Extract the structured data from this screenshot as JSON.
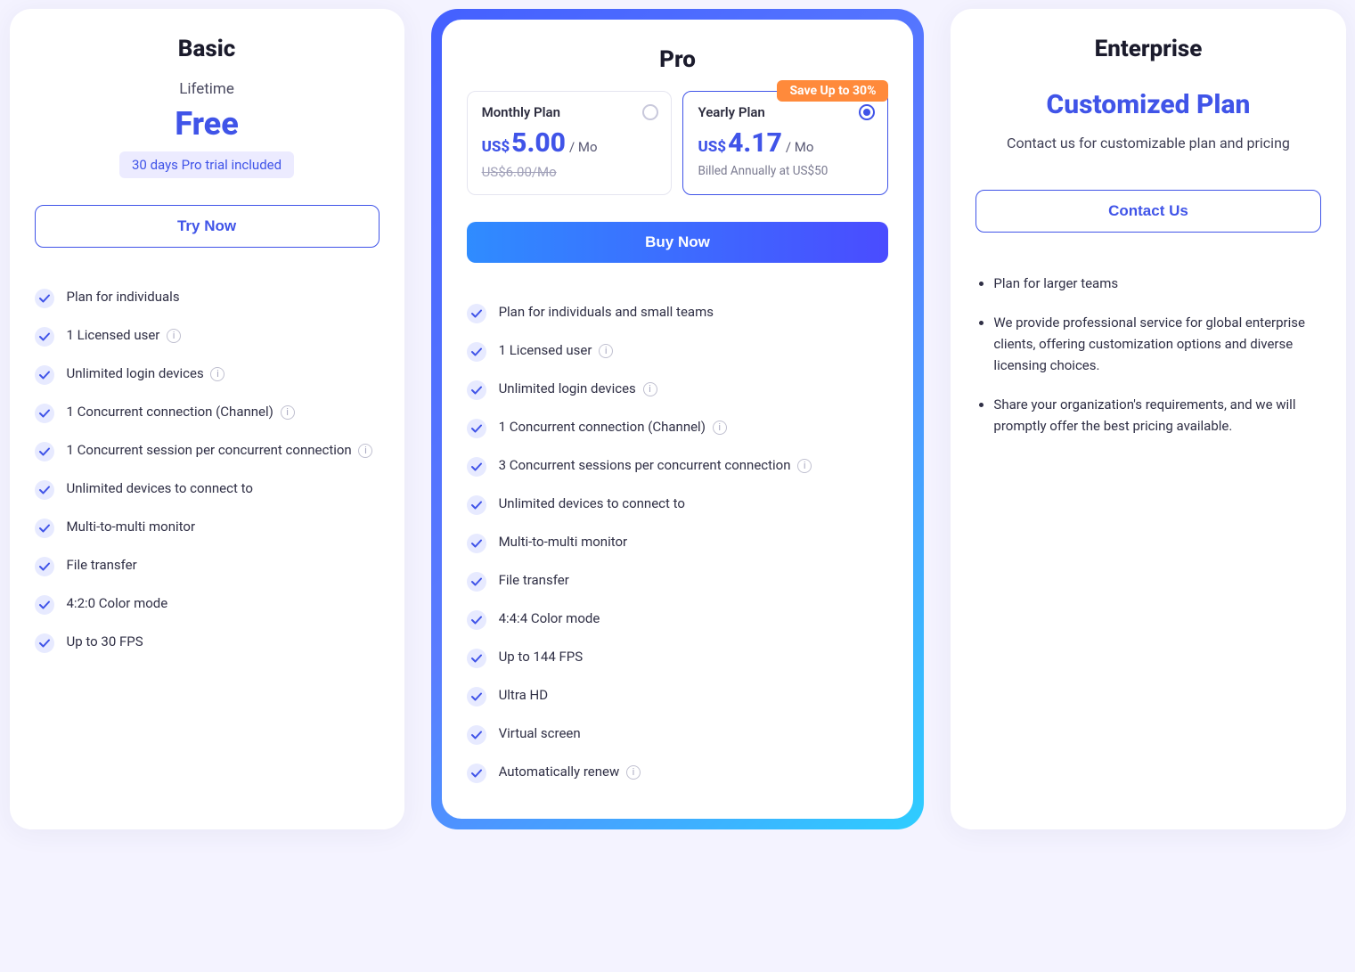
{
  "basic": {
    "title": "Basic",
    "duration": "Lifetime",
    "price": "Free",
    "trial_badge": "30 days Pro trial included",
    "cta": "Try Now",
    "features": [
      {
        "text": "Plan for individuals",
        "info": false
      },
      {
        "text": "1 Licensed user",
        "info": true
      },
      {
        "text": "Unlimited login devices",
        "info": true
      },
      {
        "text": "1 Concurrent connection (Channel)",
        "info": true
      },
      {
        "text": "1 Concurrent session per concurrent connection",
        "info": true
      },
      {
        "text": "Unlimited devices to connect to",
        "info": false
      },
      {
        "text": "Multi-to-multi monitor",
        "info": false
      },
      {
        "text": "File transfer",
        "info": false
      },
      {
        "text": "4:2:0 Color mode",
        "info": false
      },
      {
        "text": "Up to 30 FPS",
        "info": false
      }
    ]
  },
  "pro": {
    "title": "Pro",
    "save_tag": "Save Up to 30%",
    "monthly": {
      "label": "Monthly Plan",
      "currency": "US$",
      "amount": "5.00",
      "suffix": "/ Mo",
      "strike": "US$6.00/Mo"
    },
    "yearly": {
      "label": "Yearly Plan",
      "currency": "US$",
      "amount": "4.17",
      "suffix": "/ Mo",
      "sub": "Billed Annually at US$50"
    },
    "cta": "Buy Now",
    "features": [
      {
        "text": "Plan for individuals and small teams",
        "info": false
      },
      {
        "text": "1 Licensed user",
        "info": true
      },
      {
        "text": "Unlimited login devices",
        "info": true
      },
      {
        "text": "1 Concurrent connection (Channel)",
        "info": true
      },
      {
        "text": "3 Concurrent sessions per concurrent connection",
        "info": true
      },
      {
        "text": "Unlimited devices to connect to",
        "info": false
      },
      {
        "text": "Multi-to-multi monitor",
        "info": false
      },
      {
        "text": "File transfer",
        "info": false
      },
      {
        "text": "4:4:4 Color mode",
        "info": false
      },
      {
        "text": "Up to 144 FPS",
        "info": false
      },
      {
        "text": "Ultra HD",
        "info": false
      },
      {
        "text": "Virtual screen",
        "info": false
      },
      {
        "text": "Automatically renew",
        "info": true
      }
    ]
  },
  "enterprise": {
    "title": "Enterprise",
    "headline": "Customized Plan",
    "sub": "Contact us for customizable plan and pricing",
    "cta": "Contact Us",
    "bullets": [
      "Plan for larger teams",
      "We provide professional service for global enterprise clients, offering customization options and diverse licensing choices.",
      "Share your organization's requirements, and we will promptly offer the best pricing available."
    ]
  }
}
